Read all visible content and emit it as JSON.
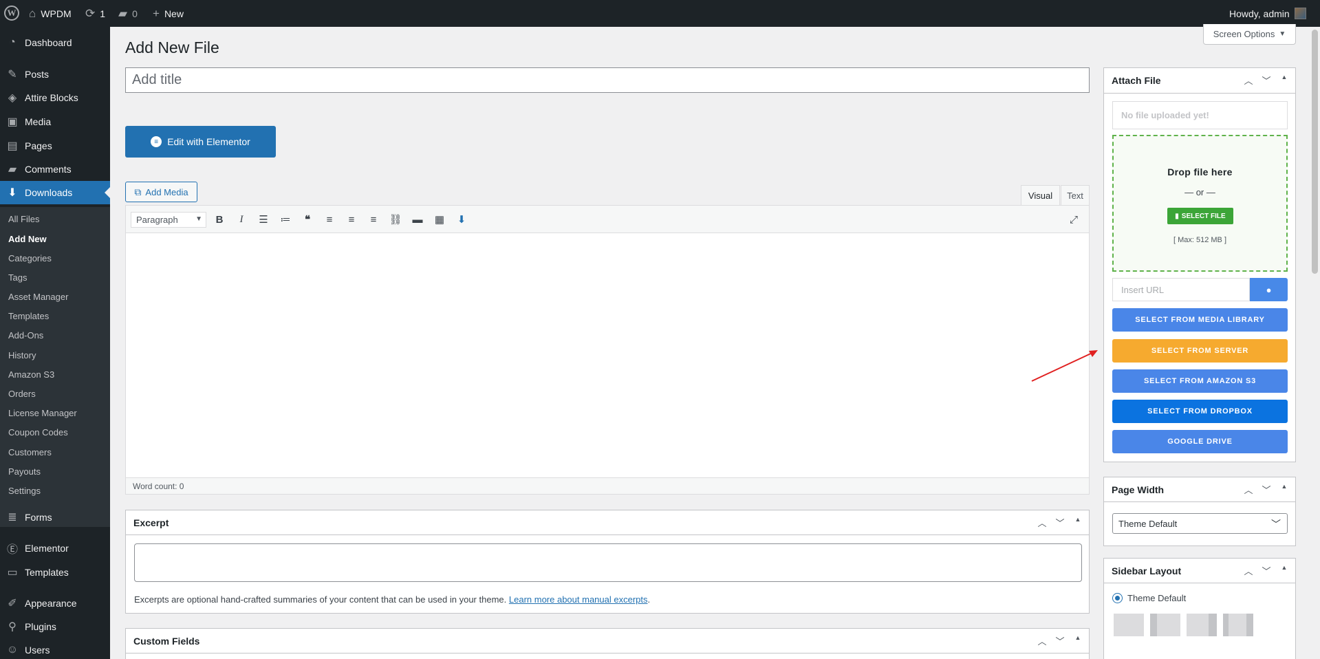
{
  "adminbar": {
    "site_name": "WPDM",
    "updates_count": "1",
    "comments_count": "0",
    "new_label": "New",
    "howdy": "Howdy, admin"
  },
  "menu": {
    "items": [
      {
        "label": "Dashboard",
        "icon": "dashboard-icon"
      },
      {
        "label": "Posts",
        "icon": "pushpin-icon"
      },
      {
        "label": "Attire Blocks",
        "icon": "blocks-icon"
      },
      {
        "label": "Media",
        "icon": "media-icon"
      },
      {
        "label": "Pages",
        "icon": "pages-icon"
      },
      {
        "label": "Comments",
        "icon": "comment-icon"
      },
      {
        "label": "Downloads",
        "icon": "download-icon"
      },
      {
        "label": "Forms",
        "icon": "forms-icon"
      },
      {
        "label": "Elementor",
        "icon": "elementor-icon"
      },
      {
        "label": "Templates",
        "icon": "folder-icon"
      },
      {
        "label": "Appearance",
        "icon": "brush-icon"
      },
      {
        "label": "Plugins",
        "icon": "plugin-icon"
      },
      {
        "label": "Users",
        "icon": "users-icon"
      }
    ],
    "submenu": [
      "All Files",
      "Add New",
      "Categories",
      "Tags",
      "Asset Manager",
      "Templates",
      "Add-Ons",
      "History",
      "Amazon S3",
      "Orders",
      "License Manager",
      "Coupon Codes",
      "Customers",
      "Payouts",
      "Settings"
    ]
  },
  "page": {
    "title": "Add New File",
    "screen_options": "Screen Options",
    "title_placeholder": "Add title",
    "elementor_button": "Edit with Elementor"
  },
  "editor": {
    "add_media": "Add Media",
    "tab_visual": "Visual",
    "tab_text": "Text",
    "format": "Paragraph",
    "word_count": "Word count: 0"
  },
  "excerpt": {
    "title": "Excerpt",
    "help": "Excerpts are optional hand-crafted summaries of your content that can be used in your theme.",
    "link": "Learn more about manual excerpts",
    "period": "."
  },
  "custom_fields": {
    "title": "Custom Fields"
  },
  "attach": {
    "title": "Attach File",
    "no_file": "No file uploaded yet!",
    "drop_here": "Drop file here",
    "or": "— or —",
    "select_file": "SELECT FILE",
    "max": "[ Max: 512 MB ]",
    "url_placeholder": "Insert URL",
    "media_library": "SELECT FROM MEDIA LIBRARY",
    "server": "SELECT FROM SERVER",
    "amazon": "SELECT FROM AMAZON S3",
    "dropbox": "SELECT FROM DROPBOX",
    "gdrive": "GOOGLE DRIVE"
  },
  "page_width": {
    "title": "Page Width",
    "value": "Theme Default"
  },
  "sidebar_layout": {
    "title": "Sidebar Layout",
    "option": "Theme Default"
  },
  "colors": {
    "admin_dark": "#1d2327",
    "accent": "#2271b1",
    "media_library_btn": "#4a86e8",
    "server_btn": "#f6aa2f",
    "amazon_btn": "#4a86e8",
    "dropbox_btn": "#0b73e0",
    "gdrive_btn": "#4a86e8",
    "select_file_btn": "#3ca538"
  }
}
